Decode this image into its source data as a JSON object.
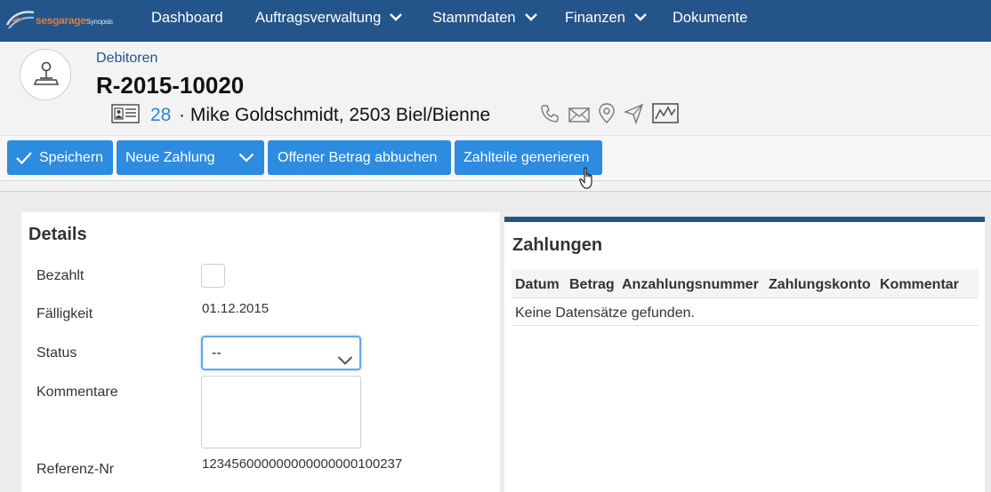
{
  "nav": {
    "brand_main": "sesgarage",
    "brand_sub": "Synopsis",
    "items": [
      {
        "label": "Dashboard",
        "has_dropdown": false
      },
      {
        "label": "Auftragsverwaltung",
        "has_dropdown": true
      },
      {
        "label": "Stammdaten",
        "has_dropdown": true
      },
      {
        "label": "Finanzen",
        "has_dropdown": true
      },
      {
        "label": "Dokumente",
        "has_dropdown": false
      }
    ]
  },
  "header": {
    "breadcrumb": "Debitoren",
    "title": "R-2015-10020",
    "customer_number": "28",
    "customer_name": "· Mike Goldschmidt, 2503 Biel/Bienne",
    "action_icons": [
      "phone-icon",
      "mail-icon",
      "location-pin-icon",
      "navigate-icon",
      "chart-icon"
    ]
  },
  "toolbar": {
    "save_label": "Speichern",
    "new_payment_label": "Neue Zahlung",
    "book_open_amount_label": "Offener Betrag abbuchen",
    "generate_installments_label": "Zahlteile generieren"
  },
  "details": {
    "title": "Details",
    "paid_label": "Bezahlt",
    "paid_checked": false,
    "due_label": "Fälligkeit",
    "due_value": "01.12.2015",
    "status_label": "Status",
    "status_value": "--",
    "comments_label": "Kommentare",
    "comments_value": "",
    "reference_label": "Referenz-Nr",
    "reference_value": "123456000000000000000100237"
  },
  "payments": {
    "title": "Zahlungen",
    "columns": [
      "Datum",
      "Betrag",
      "Anzahlungsnummer",
      "Zahlungskonto",
      "Kommentar"
    ],
    "empty_text": "Keine Datensätze gefunden."
  },
  "colors": {
    "navbar": "#23558a",
    "button": "#2d8be0",
    "link": "#2e86d6",
    "brand_orange": "#e07a3a"
  }
}
